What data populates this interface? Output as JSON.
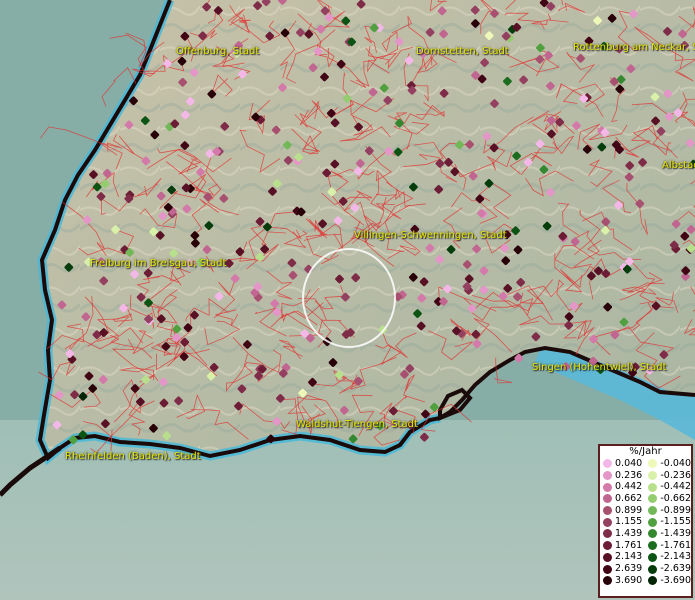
{
  "map": {
    "cities": [
      {
        "id": "offenburg",
        "label": "Offenburg, Stadt"
      },
      {
        "id": "dornstetten",
        "label": "Dornstetten, Stadt"
      },
      {
        "id": "rottenburg",
        "label": "Rottenburg am Neckar, S"
      },
      {
        "id": "albstadt",
        "label": "Albstad"
      },
      {
        "id": "villingen",
        "label": "Villingen-Schwenningen, Stadt"
      },
      {
        "id": "freiburg",
        "label": "Freiburg im Breisgau, Stadt"
      },
      {
        "id": "singen",
        "label": "Singen (Hohentwiel), Stadt"
      },
      {
        "id": "waldshut",
        "label": "Waldshut-Tiengen, Stadt"
      },
      {
        "id": "rheinfelden",
        "label": "Rheinfelden (Baden), Stadt"
      }
    ]
  },
  "legend": {
    "title": "%/Jahr",
    "positive": [
      {
        "label": "0.040",
        "color": "#f4b8e8"
      },
      {
        "label": "0.236",
        "color": "#e496c8"
      },
      {
        "label": "0.442",
        "color": "#d47aaa"
      },
      {
        "label": "0.662",
        "color": "#c06690"
      },
      {
        "label": "0.899",
        "color": "#a85070"
      },
      {
        "label": "1.155",
        "color": "#944060"
      },
      {
        "label": "1.439",
        "color": "#7e2c48"
      },
      {
        "label": "1.761",
        "color": "#6c1c34"
      },
      {
        "label": "2.143",
        "color": "#581024"
      },
      {
        "label": "2.639",
        "color": "#400414"
      },
      {
        "label": "3.690",
        "color": "#280008"
      }
    ],
    "negative": [
      {
        "label": "-0.040",
        "color": "#eef8b8"
      },
      {
        "label": "-0.236",
        "color": "#d8f0a8"
      },
      {
        "label": "-0.442",
        "color": "#b8e08c"
      },
      {
        "label": "-0.662",
        "color": "#94cc70"
      },
      {
        "label": "-0.899",
        "color": "#72b858"
      },
      {
        "label": "-1.155",
        "color": "#50a040"
      },
      {
        "label": "-1.439",
        "color": "#348830"
      },
      {
        "label": "-1.761",
        "color": "#1c6c20"
      },
      {
        "label": "-2.143",
        "color": "#0c5414"
      },
      {
        "label": "-2.639",
        "color": "#043c0c"
      },
      {
        "label": "-3.690",
        "color": "#002404"
      }
    ]
  }
}
